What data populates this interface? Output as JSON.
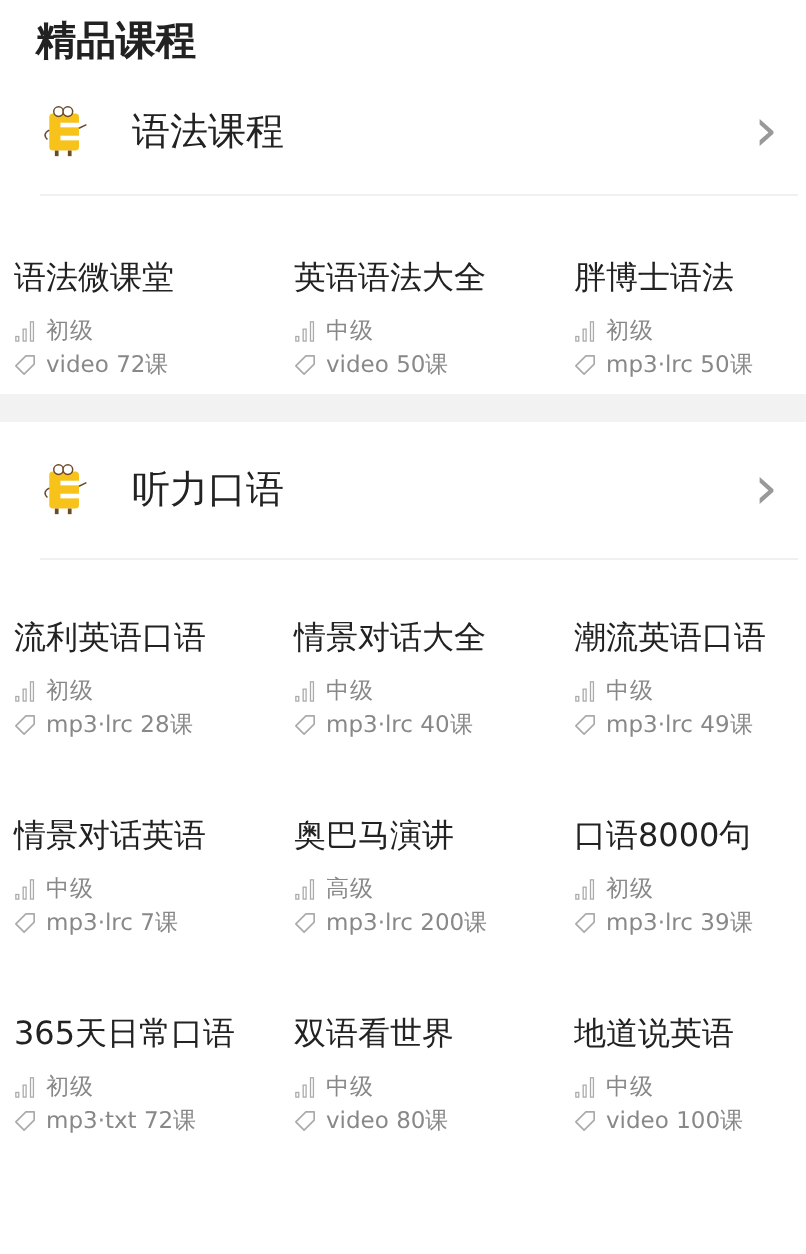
{
  "title": "精品课程",
  "sections": [
    {
      "name": "语法课程",
      "arrow": "›",
      "courses": [
        {
          "title": "语法微课堂",
          "level": "初级",
          "format": "video 72课"
        },
        {
          "title": "英语语法大全",
          "level": "中级",
          "format": "video 50课"
        },
        {
          "title": "胖博士语法",
          "level": "初级",
          "format": "mp3·lrc 50课"
        }
      ]
    },
    {
      "name": "听力口语",
      "arrow": "›",
      "courses": [
        {
          "title": "流利英语口语",
          "level": "初级",
          "format": "mp3·lrc 28课"
        },
        {
          "title": "情景对话大全",
          "level": "中级",
          "format": "mp3·lrc 40课"
        },
        {
          "title": "潮流英语口语",
          "level": "中级",
          "format": "mp3·lrc 49课"
        },
        {
          "title": "情景对话英语",
          "level": "中级",
          "format": "mp3·lrc 7课"
        },
        {
          "title": "奥巴马演讲",
          "level": "高级",
          "format": "mp3·lrc 200课"
        },
        {
          "title": "口语8000句",
          "level": "初级",
          "format": "mp3·lrc 39课"
        },
        {
          "title": "365天日常口语",
          "level": "初级",
          "format": "mp3·txt 72课"
        },
        {
          "title": "双语看世界",
          "level": "中级",
          "format": "video 80课"
        },
        {
          "title": "地道说英语",
          "level": "中级",
          "format": "video 100课"
        }
      ]
    }
  ]
}
